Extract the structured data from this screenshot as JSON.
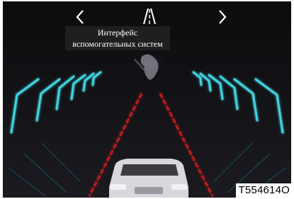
{
  "header": {
    "title": "Интерфейс вспомогательных систем",
    "prev_icon": "chevron-left-icon",
    "next_icon": "chevron-right-icon",
    "mode_icon": "lane-road-icon"
  },
  "scene": {
    "description_icons": [
      "lane-line-icon",
      "vehicle-icon",
      "rear-camera-icon"
    ]
  },
  "figure_code": "T554614O",
  "colors": {
    "background": "#0c0c0e",
    "lane_marker": "#3fd3e0",
    "lane_line": "#d02525",
    "text": "#ffffff"
  }
}
